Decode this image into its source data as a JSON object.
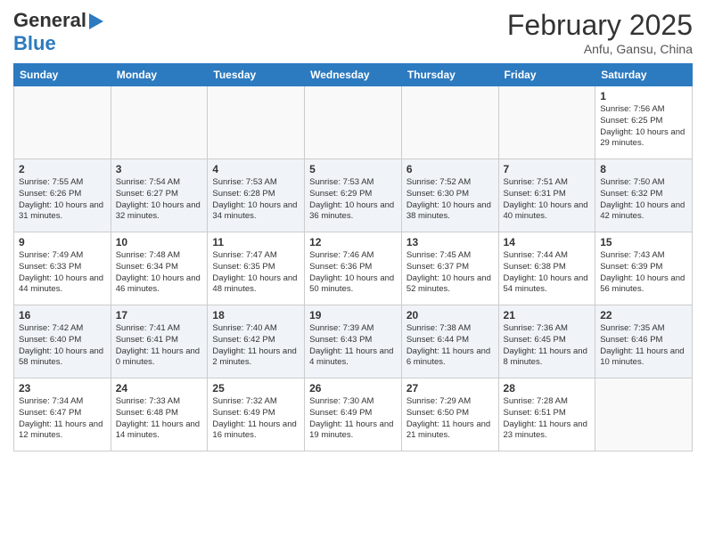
{
  "header": {
    "logo_line1": "General",
    "logo_line2": "Blue",
    "month": "February 2025",
    "location": "Anfu, Gansu, China"
  },
  "weekdays": [
    "Sunday",
    "Monday",
    "Tuesday",
    "Wednesday",
    "Thursday",
    "Friday",
    "Saturday"
  ],
  "weeks": [
    [
      {
        "day": "",
        "info": ""
      },
      {
        "day": "",
        "info": ""
      },
      {
        "day": "",
        "info": ""
      },
      {
        "day": "",
        "info": ""
      },
      {
        "day": "",
        "info": ""
      },
      {
        "day": "",
        "info": ""
      },
      {
        "day": "1",
        "info": "Sunrise: 7:56 AM\nSunset: 6:25 PM\nDaylight: 10 hours and 29 minutes."
      }
    ],
    [
      {
        "day": "2",
        "info": "Sunrise: 7:55 AM\nSunset: 6:26 PM\nDaylight: 10 hours and 31 minutes."
      },
      {
        "day": "3",
        "info": "Sunrise: 7:54 AM\nSunset: 6:27 PM\nDaylight: 10 hours and 32 minutes."
      },
      {
        "day": "4",
        "info": "Sunrise: 7:53 AM\nSunset: 6:28 PM\nDaylight: 10 hours and 34 minutes."
      },
      {
        "day": "5",
        "info": "Sunrise: 7:53 AM\nSunset: 6:29 PM\nDaylight: 10 hours and 36 minutes."
      },
      {
        "day": "6",
        "info": "Sunrise: 7:52 AM\nSunset: 6:30 PM\nDaylight: 10 hours and 38 minutes."
      },
      {
        "day": "7",
        "info": "Sunrise: 7:51 AM\nSunset: 6:31 PM\nDaylight: 10 hours and 40 minutes."
      },
      {
        "day": "8",
        "info": "Sunrise: 7:50 AM\nSunset: 6:32 PM\nDaylight: 10 hours and 42 minutes."
      }
    ],
    [
      {
        "day": "9",
        "info": "Sunrise: 7:49 AM\nSunset: 6:33 PM\nDaylight: 10 hours and 44 minutes."
      },
      {
        "day": "10",
        "info": "Sunrise: 7:48 AM\nSunset: 6:34 PM\nDaylight: 10 hours and 46 minutes."
      },
      {
        "day": "11",
        "info": "Sunrise: 7:47 AM\nSunset: 6:35 PM\nDaylight: 10 hours and 48 minutes."
      },
      {
        "day": "12",
        "info": "Sunrise: 7:46 AM\nSunset: 6:36 PM\nDaylight: 10 hours and 50 minutes."
      },
      {
        "day": "13",
        "info": "Sunrise: 7:45 AM\nSunset: 6:37 PM\nDaylight: 10 hours and 52 minutes."
      },
      {
        "day": "14",
        "info": "Sunrise: 7:44 AM\nSunset: 6:38 PM\nDaylight: 10 hours and 54 minutes."
      },
      {
        "day": "15",
        "info": "Sunrise: 7:43 AM\nSunset: 6:39 PM\nDaylight: 10 hours and 56 minutes."
      }
    ],
    [
      {
        "day": "16",
        "info": "Sunrise: 7:42 AM\nSunset: 6:40 PM\nDaylight: 10 hours and 58 minutes."
      },
      {
        "day": "17",
        "info": "Sunrise: 7:41 AM\nSunset: 6:41 PM\nDaylight: 11 hours and 0 minutes."
      },
      {
        "day": "18",
        "info": "Sunrise: 7:40 AM\nSunset: 6:42 PM\nDaylight: 11 hours and 2 minutes."
      },
      {
        "day": "19",
        "info": "Sunrise: 7:39 AM\nSunset: 6:43 PM\nDaylight: 11 hours and 4 minutes."
      },
      {
        "day": "20",
        "info": "Sunrise: 7:38 AM\nSunset: 6:44 PM\nDaylight: 11 hours and 6 minutes."
      },
      {
        "day": "21",
        "info": "Sunrise: 7:36 AM\nSunset: 6:45 PM\nDaylight: 11 hours and 8 minutes."
      },
      {
        "day": "22",
        "info": "Sunrise: 7:35 AM\nSunset: 6:46 PM\nDaylight: 11 hours and 10 minutes."
      }
    ],
    [
      {
        "day": "23",
        "info": "Sunrise: 7:34 AM\nSunset: 6:47 PM\nDaylight: 11 hours and 12 minutes."
      },
      {
        "day": "24",
        "info": "Sunrise: 7:33 AM\nSunset: 6:48 PM\nDaylight: 11 hours and 14 minutes."
      },
      {
        "day": "25",
        "info": "Sunrise: 7:32 AM\nSunset: 6:49 PM\nDaylight: 11 hours and 16 minutes."
      },
      {
        "day": "26",
        "info": "Sunrise: 7:30 AM\nSunset: 6:49 PM\nDaylight: 11 hours and 19 minutes."
      },
      {
        "day": "27",
        "info": "Sunrise: 7:29 AM\nSunset: 6:50 PM\nDaylight: 11 hours and 21 minutes."
      },
      {
        "day": "28",
        "info": "Sunrise: 7:28 AM\nSunset: 6:51 PM\nDaylight: 11 hours and 23 minutes."
      },
      {
        "day": "",
        "info": ""
      }
    ]
  ]
}
